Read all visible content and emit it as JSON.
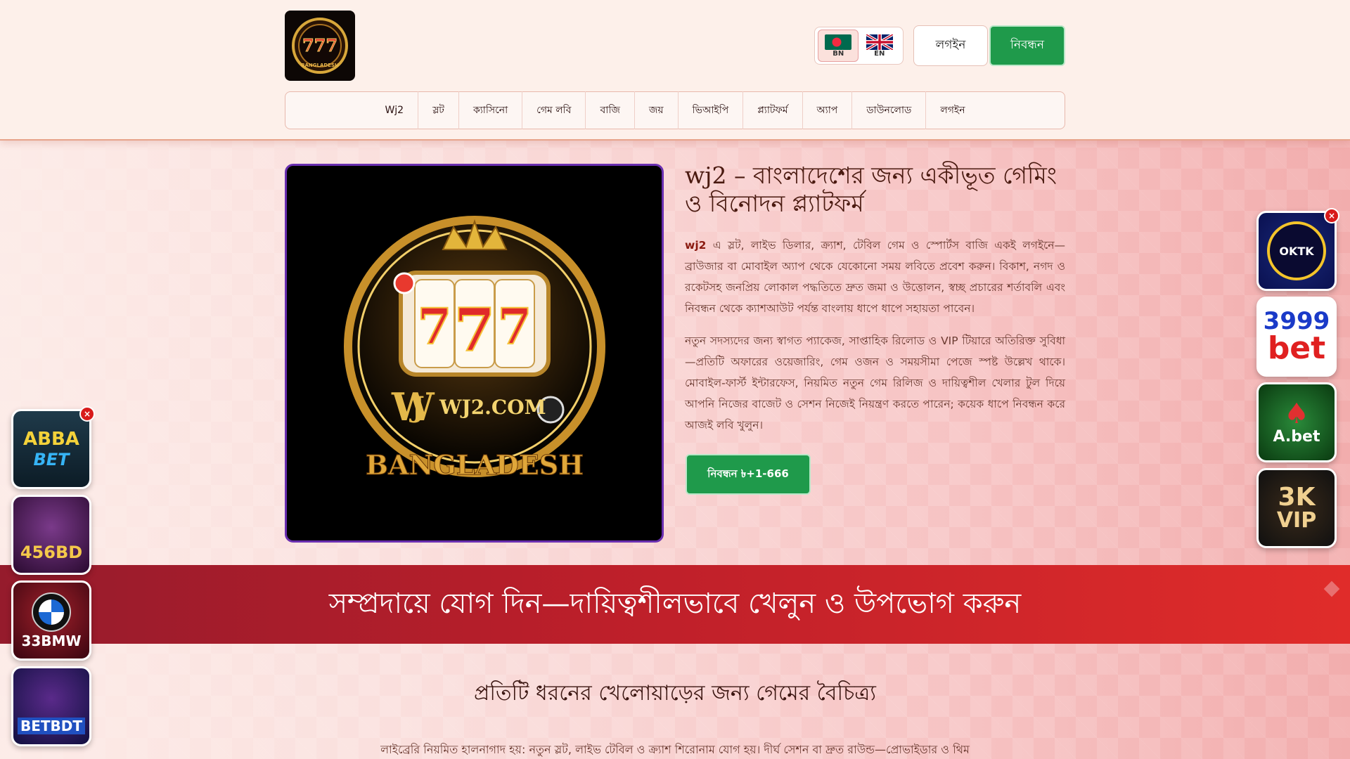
{
  "logo": {
    "alt": "777 Bangladesh"
  },
  "languages": [
    {
      "code": "BN",
      "flag": "bd-flag-icon"
    },
    {
      "code": "EN",
      "flag": "uk-flag-icon"
    }
  ],
  "header": {
    "login_label": "লগইন",
    "register_label": "নিবন্ধন"
  },
  "nav": {
    "items": [
      "Wj2",
      "স্লট",
      "ক্যাসিনো",
      "গেম লবি",
      "বাজি",
      "জয়",
      "ভিআইপি",
      "প্ল্যাটফর্ম",
      "অ্যাপ",
      "ডাউনলোড",
      "লগইন"
    ]
  },
  "hero": {
    "image": {
      "line1": "WJ2.COM",
      "line2": "BANGLADESH",
      "reels": "777"
    },
    "title": "wj2 – বাংলাদেশের জন্য একীভূত গেমিং ও বিনোদন প্ল্যাটফর্ম",
    "p1_brand": "wj2",
    "p1_text": " এ স্লট, লাইভ ডিলার, ক্র্যাশ, টেবিল গেম ও স্পোর্টস বাজি একই লগইনে—ব্রাউজার বা মোবাইল অ্যাপ থেকে যেকোনো সময় লবিতে প্রবেশ করুন। বিকাশ, নগদ ও রকেটসহ জনপ্রিয় লোকাল পদ্ধতিতে দ্রুত জমা ও উত্তোলন, স্বচ্ছ প্রচারের শর্তাবলি এবং নিবন্ধন থেকে ক্যাশআউট পর্যন্ত বাংলায় ধাপে ধাপে সহায়তা পাবেন।",
    "p2": "নতুন সদস্যদের জন্য স্বাগত প্যাকেজ, সাপ্তাহিক রিলোড ও VIP টিয়ারে অতিরিক্ত সুবিধা—প্রতিটি অফারের ওয়েজারিং, গেম ওজন ও সময়সীমা পেজে স্পষ্ট উল্লেখ থাকে। মোবাইল-ফার্স্ট ইন্টারফেস, নিয়মিত নতুন গেম রিলিজ ও দায়িত্বশীল খেলার টুল দিয়ে আপনি নিজের বাজেট ও সেশন নিজেই নিয়ন্ত্রণ করতে পারেন; কয়েক ধাপে নিবন্ধন করে আজই লবি খুলুন।",
    "cta_label": "নিবন্ধন ৳+1-666"
  },
  "banner": {
    "text": "সম্প্রদায়ে যোগ দিন—দায়িত্বশীলভাবে খেলুন ও উপভোগ করুন"
  },
  "section": {
    "title": "প্রতিটি ধরনের খেলোয়াড়ের জন্য গেমের বৈচিত্র্য",
    "subtitle": "লাইব্রেরি নিয়মিত হালনাগাদ হয়: নতুন স্লট, লাইভ টেবিল ও ক্র্যাশ শিরোনাম যোগ হয়। দীর্ঘ সেশন বা দ্রুত রাউন্ড—প্রোভাইডার ও থিম"
  },
  "ads_left": [
    {
      "l1": "ABBA",
      "l2": "BET"
    },
    {
      "l1": "456BD",
      "l2": ""
    },
    {
      "l1": "33BMW",
      "l2": "BMW"
    },
    {
      "l1": "BETBDT",
      "l2": ""
    }
  ],
  "ads_right": [
    {
      "l1": "OKTK",
      "l2": ""
    },
    {
      "l1": "3999",
      "l2": "bet"
    },
    {
      "l1": "A.bet",
      "l2": ""
    },
    {
      "l1": "3K",
      "l2": "VIP"
    }
  ],
  "close_symbol": "×",
  "colors": {
    "accent_green": "#1f9a4b",
    "banner_red": "#bd1f2a",
    "header_bg": "#fdf0ea"
  }
}
